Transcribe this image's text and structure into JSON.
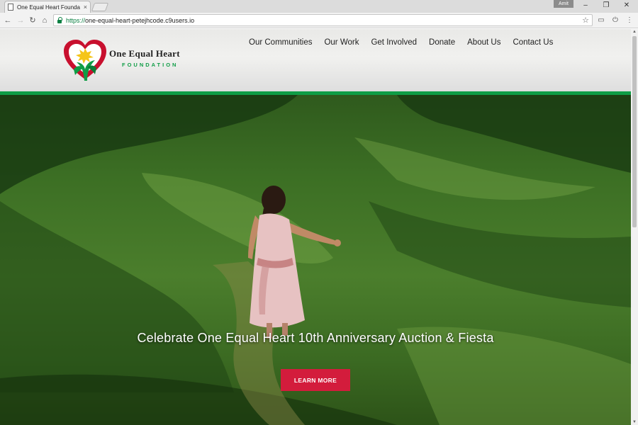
{
  "browser": {
    "tab_title": "One Equal Heart Founda",
    "tab_close": "×",
    "profile_label": "Amit",
    "url_scheme": "https://",
    "url_rest": "one-equal-heart-petejhcode.c9users.io",
    "icons": {
      "back": "←",
      "forward": "→",
      "reload": "↻",
      "home": "⌂",
      "bookmark": "☆",
      "cast": "▭",
      "power": "⏻",
      "menu": "⋮",
      "minimize": "–",
      "restore": "❐",
      "close": "✕",
      "scroll_up": "▲",
      "scroll_down": "▼"
    }
  },
  "logo": {
    "name": "One Equal Heart",
    "subtitle": "FOUNDATION"
  },
  "nav": [
    {
      "label": "Our Communities"
    },
    {
      "label": "Our Work"
    },
    {
      "label": "Get Involved"
    },
    {
      "label": "Donate"
    },
    {
      "label": "About Us"
    },
    {
      "label": "Contact Us"
    }
  ],
  "hero": {
    "caption": "Celebrate One Equal Heart 10th Anniversary Auction & Fiesta",
    "button_label": "LEARN MORE"
  },
  "colors": {
    "brand_green": "#0f9d46",
    "brand_red": "#d31c3c",
    "heart_red": "#c8102e",
    "sun_yellow": "#f5c518"
  }
}
